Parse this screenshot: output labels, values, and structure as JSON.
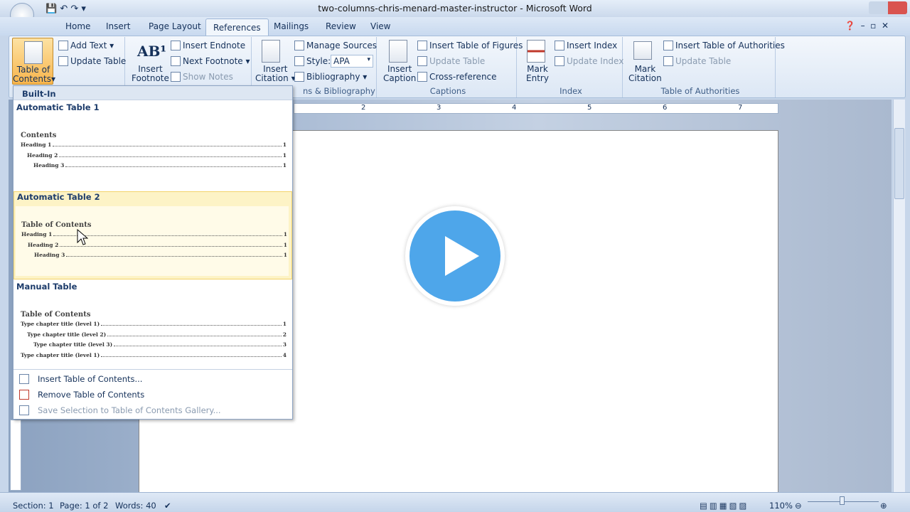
{
  "window": {
    "title": "two-columns-chris-menard-master-instructor - Microsoft Word"
  },
  "tabs": [
    "Home",
    "Insert",
    "Page Layout",
    "References",
    "Mailings",
    "Review",
    "View"
  ],
  "active_tab": "References",
  "ribbon": {
    "toc": {
      "label1": "Table of",
      "label2": "Contents",
      "add_text": "Add Text",
      "update_table": "Update Table"
    },
    "footnotes": {
      "insert_footnote1": "Insert",
      "insert_footnote2": "Footnote",
      "insert_endnote": "Insert Endnote",
      "next_footnote": "Next Footnote",
      "show_notes": "Show Notes"
    },
    "citations": {
      "insert_citation1": "Insert",
      "insert_citation2": "Citation",
      "manage_sources": "Manage Sources",
      "style_label": "Style:",
      "style_value": "APA",
      "bibliography": "Bibliography",
      "group": "ns & Bibliography"
    },
    "captions": {
      "insert_caption1": "Insert",
      "insert_caption2": "Caption",
      "insert_tof": "Insert Table of Figures",
      "update_table": "Update Table",
      "cross_reference": "Cross-reference",
      "group": "Captions"
    },
    "index": {
      "mark_entry1": "Mark",
      "mark_entry2": "Entry",
      "insert_index": "Insert Index",
      "update_index": "Update Index",
      "group": "Index"
    },
    "toa": {
      "mark_citation1": "Mark",
      "mark_citation2": "Citation",
      "insert_toa": "Insert Table of Authorities",
      "update_table": "Update Table",
      "group": "Table of Authorities"
    }
  },
  "dropdown": {
    "header": "Built-In",
    "auto1": {
      "name": "Automatic Table 1",
      "title": "Contents",
      "rows": [
        [
          "Heading 1",
          "1"
        ],
        [
          "Heading 2",
          "1"
        ],
        [
          "Heading 3",
          "1"
        ]
      ]
    },
    "auto2": {
      "name": "Automatic Table 2",
      "title": "Table of Contents",
      "rows": [
        [
          "Heading 1",
          "1"
        ],
        [
          "Heading 2",
          "1"
        ],
        [
          "Heading 3",
          "1"
        ]
      ]
    },
    "manual": {
      "name": "Manual Table",
      "title": "Table of Contents",
      "rows": [
        [
          "Type chapter title (level 1)",
          "1"
        ],
        [
          "Type chapter title (level 2)",
          "2"
        ],
        [
          "Type chapter title (level 3)",
          "3"
        ],
        [
          "Type chapter title (level 1)",
          "4"
        ]
      ]
    },
    "menu": [
      "Insert Table of Contents...",
      "Remove Table of Contents",
      "Save Selection to Table of Contents Gallery..."
    ]
  },
  "ruler": [
    "2",
    "3",
    "4",
    "5",
    "6",
    "7"
  ],
  "status": {
    "section": "Section: 1",
    "page": "Page: 1 of 2",
    "words": "Words: 40",
    "zoom": "110%"
  },
  "colors": {
    "accent": "#4ea6ea",
    "highlight": "#fdf3c6"
  }
}
